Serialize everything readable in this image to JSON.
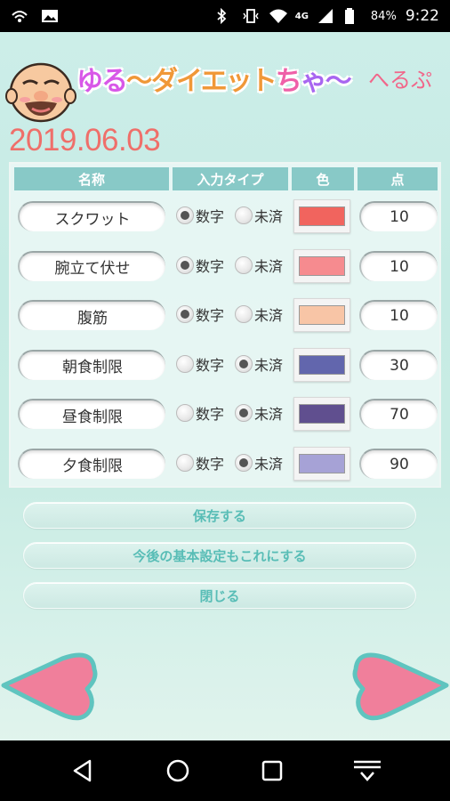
{
  "status_bar": {
    "network": "4G",
    "battery": "84%",
    "time": "9:22"
  },
  "header": {
    "logo_parts": [
      "ゆる",
      "〜",
      "ダイエット",
      "ち",
      "ゃ〜"
    ],
    "help_label": "へるぷ"
  },
  "date": "2019.06.03",
  "table": {
    "headers": [
      "名称",
      "入力タイプ",
      "色",
      "点"
    ],
    "option_number": "数字",
    "option_done": "未済",
    "rows": [
      {
        "name": "スクワット",
        "type": "number",
        "color": "#f1645e",
        "point": "10"
      },
      {
        "name": "腕立て伏せ",
        "type": "number",
        "color": "#f68b8f",
        "point": "10"
      },
      {
        "name": "腹筋",
        "type": "number",
        "color": "#f8c5a6",
        "point": "10"
      },
      {
        "name": "朝食制限",
        "type": "done",
        "color": "#6266ad",
        "point": "30"
      },
      {
        "name": "昼食制限",
        "type": "done",
        "color": "#604f8f",
        "point": "70"
      },
      {
        "name": "夕食制限",
        "type": "done",
        "color": "#a6a2d6",
        "point": "90"
      }
    ]
  },
  "buttons": {
    "save": "保存する",
    "set_default": "今後の基本設定もこれにする",
    "close": "閉じる"
  },
  "colors": {
    "accent": "#58bdb6",
    "header_bg": "#88c9c7",
    "date": "#ef6f6a",
    "help": "#f1668a",
    "heart": "#f07f9b"
  }
}
